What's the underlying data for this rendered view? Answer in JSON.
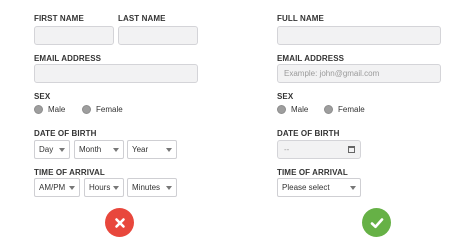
{
  "left_form": {
    "first_name_label": "FIRST NAME",
    "last_name_label": "LAST NAME",
    "email_label": "EMAIL ADDRESS",
    "sex_label": "SEX",
    "sex_options": [
      "Male",
      "Female"
    ],
    "dob_label": "DATE OF BIRTH",
    "dob_day": "Day",
    "dob_month": "Month",
    "dob_year": "Year",
    "arrival_label": "TIME OF ARRIVAL",
    "arrival_ampm": "AM/PM",
    "arrival_hours": "Hours",
    "arrival_minutes": "Minutes",
    "status_icon": "x-icon",
    "status_color": "#e8473c"
  },
  "right_form": {
    "full_name_label": "FULL NAME",
    "email_label": "EMAIL ADDRESS",
    "email_placeholder": "Example: john@gmail.com",
    "sex_label": "SEX",
    "sex_options": [
      "Male",
      "Female"
    ],
    "dob_label": "DATE OF BIRTH",
    "dob_value": "--",
    "arrival_label": "TIME OF ARRIVAL",
    "arrival_select": "Please select",
    "status_icon": "check-icon",
    "status_color": "#66b146"
  }
}
